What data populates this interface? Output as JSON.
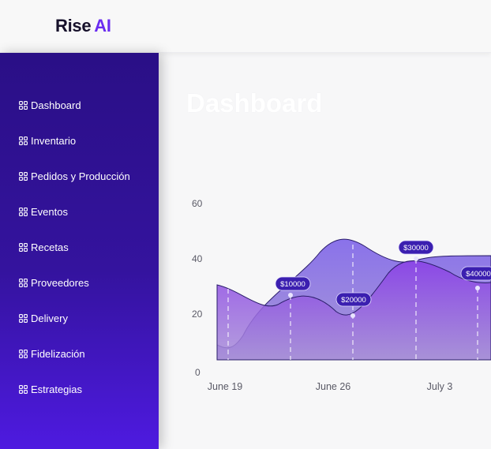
{
  "brand": {
    "name": "Rise",
    "accent": "AI",
    "accent_color": "#6a2cf0"
  },
  "sidebar": {
    "items": [
      {
        "label": "Dashboard"
      },
      {
        "label": "Inventario"
      },
      {
        "label": "Pedidos y Producción"
      },
      {
        "label": "Eventos"
      },
      {
        "label": "Recetas"
      },
      {
        "label": "Proveedores"
      },
      {
        "label": "Delivery"
      },
      {
        "label": "Fidelización"
      },
      {
        "label": "Estrategias"
      }
    ]
  },
  "main": {
    "title": "Dashboard"
  },
  "chart_data": {
    "type": "area",
    "x": [
      "June 19",
      "June 26",
      "July 3"
    ],
    "y_ticks": [
      "0",
      "20",
      "40",
      "60"
    ],
    "ylim": [
      0,
      60
    ],
    "tooltips": [
      {
        "label": "$10000"
      },
      {
        "label": "$20000"
      },
      {
        "label": "$30000"
      },
      {
        "label": "$40000"
      }
    ],
    "colors": {
      "primary": "#7c3aed",
      "secondary": "#8b7cf0",
      "tooltip": "#3b1fb0"
    }
  }
}
